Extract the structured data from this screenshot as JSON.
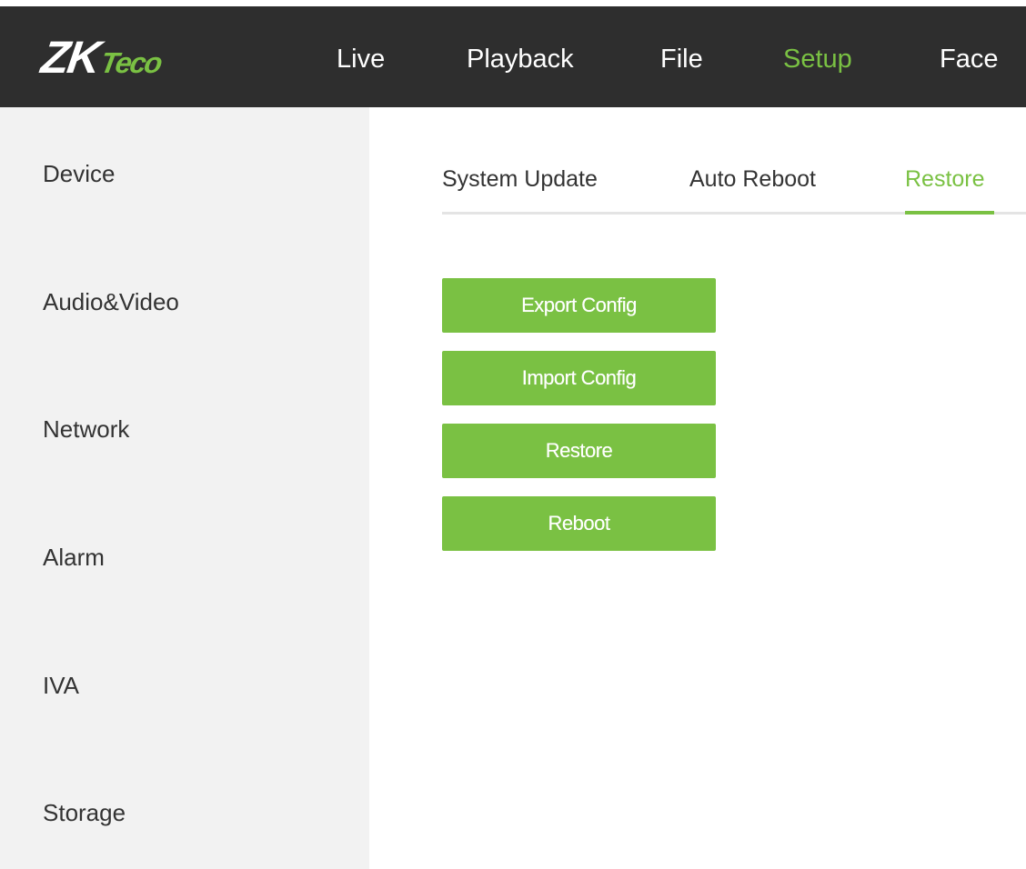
{
  "header": {
    "logo": {
      "main": "ZK",
      "accent": "Teco"
    },
    "nav": [
      {
        "label": "Live",
        "active": false
      },
      {
        "label": "Playback",
        "active": false
      },
      {
        "label": "File",
        "active": false
      },
      {
        "label": "Setup",
        "active": true
      },
      {
        "label": "Face",
        "active": false
      }
    ]
  },
  "sidebar": {
    "items": [
      {
        "label": "Device"
      },
      {
        "label": "Audio&Video"
      },
      {
        "label": "Network"
      },
      {
        "label": "Alarm"
      },
      {
        "label": "IVA"
      },
      {
        "label": "Storage"
      }
    ]
  },
  "tabs": [
    {
      "label": "System Update",
      "active": false
    },
    {
      "label": "Auto Reboot",
      "active": false
    },
    {
      "label": "Restore",
      "active": true
    }
  ],
  "actions": {
    "export_label": "Export Config",
    "import_label": "Import Config",
    "restore_label": "Restore",
    "reboot_label": "Reboot"
  },
  "colors": {
    "accent": "#7ac143",
    "header_bg": "#2e2e2e",
    "sidebar_bg": "#f2f2f2",
    "text": "#333333"
  }
}
